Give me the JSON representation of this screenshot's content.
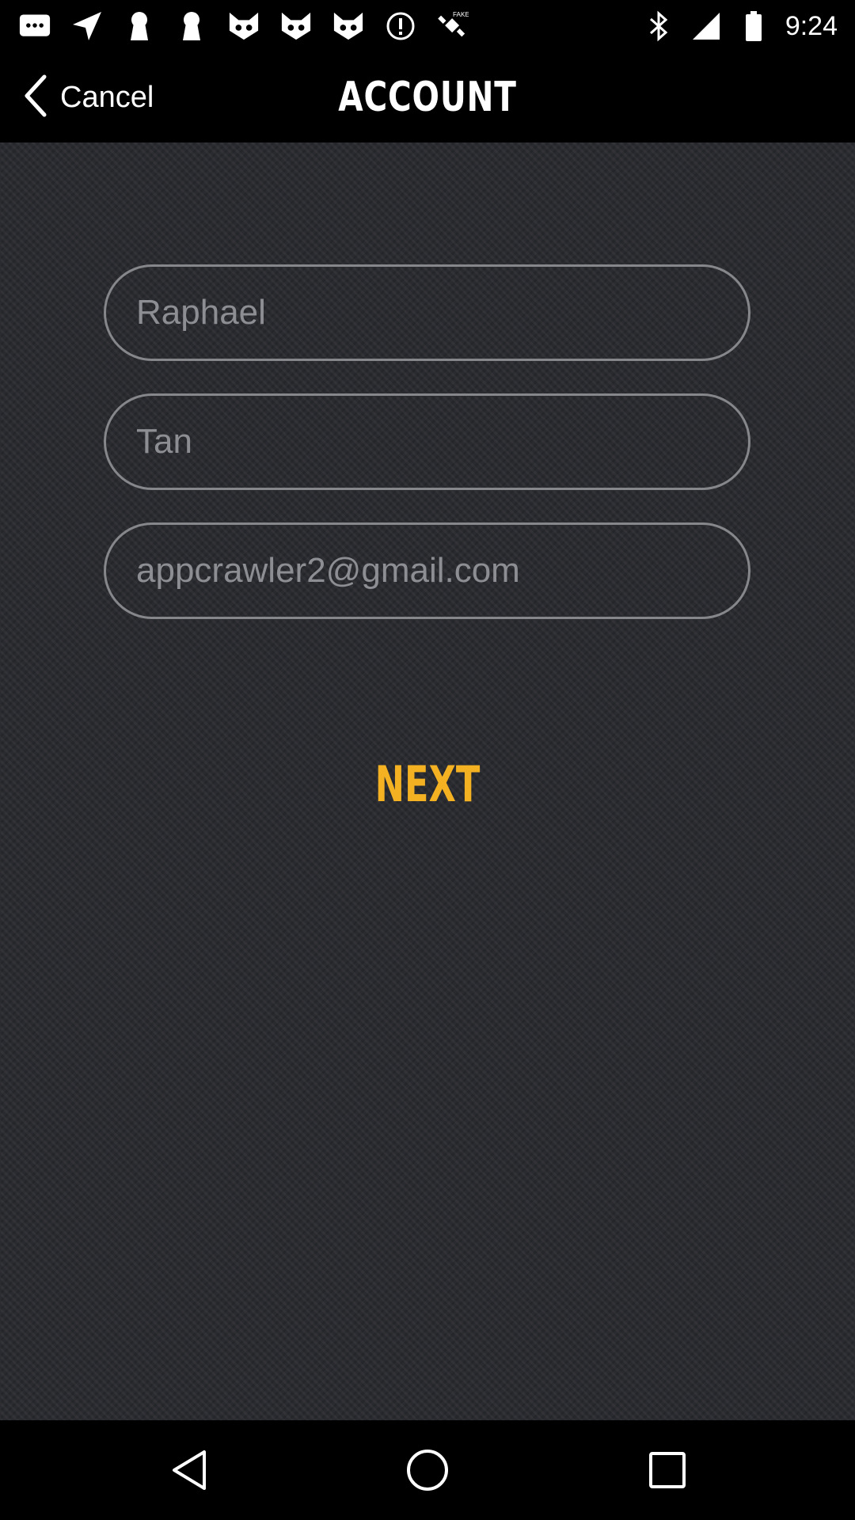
{
  "status_bar": {
    "time": "9:24",
    "icons_left": [
      "message-icon",
      "navigation-icon",
      "keyhole-icon",
      "keyhole-icon",
      "cat-face-icon",
      "cat-face-icon",
      "cat-face-icon",
      "info-circle-icon",
      "satellite-icon"
    ],
    "fake_label": "FAKE",
    "icons_right": [
      "bluetooth-icon",
      "signal-icon",
      "battery-icon"
    ]
  },
  "header": {
    "back_label": "Cancel",
    "title": "ACCOUNT"
  },
  "form": {
    "first_name": "Raphael",
    "last_name": "Tan",
    "email": "appcrawler2@gmail.com",
    "next_label": "NEXT"
  },
  "colors": {
    "accent": "#f4b223",
    "background": "#2a2b30",
    "field_border": "#86878b"
  },
  "nav_bar": {
    "icons": [
      "back-triangle-icon",
      "home-circle-icon",
      "recents-square-icon"
    ]
  }
}
